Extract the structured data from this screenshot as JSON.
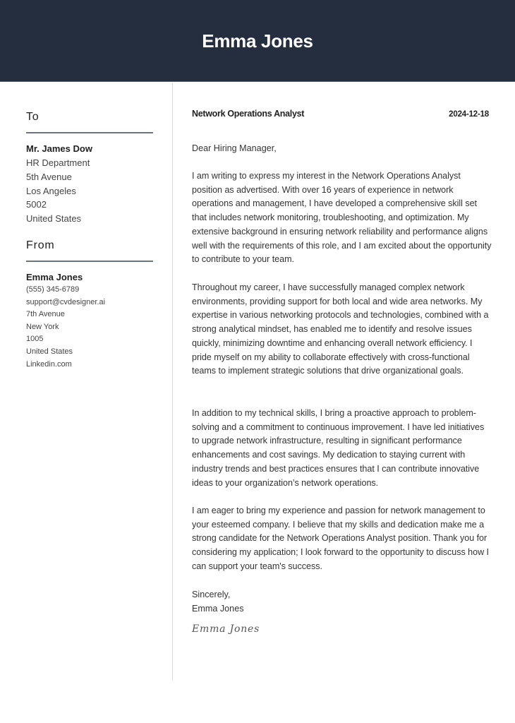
{
  "header": {
    "name": "Emma Jones",
    "background_color": "#252e3f"
  },
  "recipient": {
    "section_title": "To",
    "name": "Mr. James Dow",
    "lines": [
      "HR Department",
      "5th Avenue",
      "Los Angeles",
      "5002",
      "United States"
    ]
  },
  "sender": {
    "section_title": "From",
    "name": "Emma Jones",
    "lines": [
      "(555) 345-6789",
      "support@cvdesigner.ai",
      "7th Avenue",
      "New York",
      "1005",
      "United States",
      "Linkedin.com"
    ]
  },
  "letter": {
    "job_title": "Network Operations Analyst",
    "date": "2024-12-18",
    "greeting": "Dear Hiring Manager,",
    "paragraphs": [
      "I am writing to express my interest in the Network Operations Analyst position as advertised. With over 16 years of experience in network operations and management, I have developed a comprehensive skill set that includes network monitoring, troubleshooting, and optimization. My extensive background in ensuring network reliability and performance aligns well with the requirements of this role, and I am excited about the opportunity to contribute to your team.",
      "Throughout my career, I have successfully managed complex network environments, providing support for both local and wide area networks. My expertise in various networking protocols and technologies, combined with a strong analytical mindset, has enabled me to identify and resolve issues quickly, minimizing downtime and enhancing overall network efficiency. I pride myself on my ability to collaborate effectively with cross-functional teams to implement strategic solutions that drive organizational goals.",
      "In addition to my technical skills, I bring a proactive approach to problem-solving and a commitment to continuous improvement. I have led initiatives to upgrade network infrastructure, resulting in significant performance enhancements and cost savings. My dedication to staying current with industry trends and best practices ensures that I can contribute innovative ideas to your organization’s network operations.",
      "I am eager to bring my experience and passion for network management to your esteemed company. I believe that my skills and dedication make me a strong candidate for the Network Operations Analyst position. Thank you for considering my application; I look forward to the opportunity to discuss how I can support your team's success."
    ],
    "closing": "Sincerely,",
    "closing_name": "Emma Jones",
    "signature": "Emma Jones"
  }
}
